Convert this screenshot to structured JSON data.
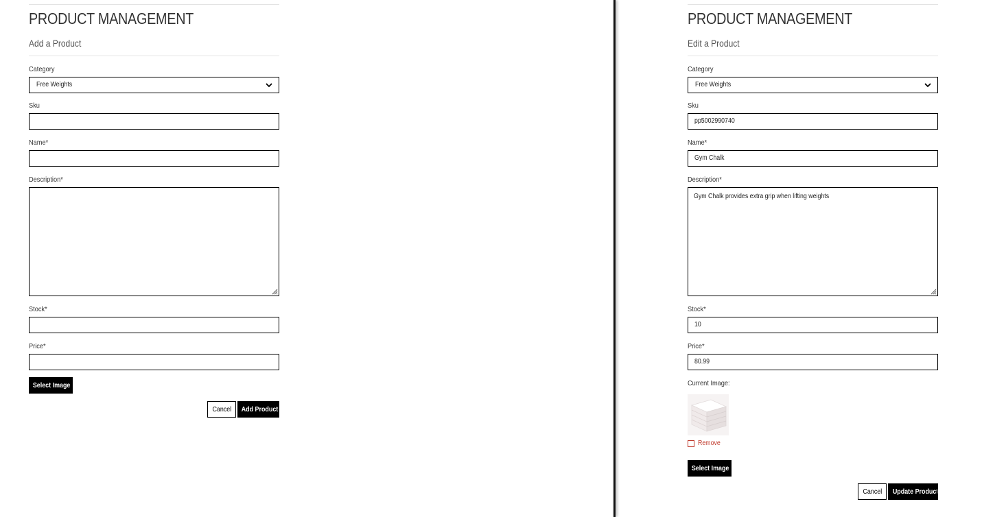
{
  "add_form": {
    "page_title": "PRODUCT MANAGEMENT",
    "subtitle": "Add a Product",
    "category": {
      "label": "Category",
      "value": "Free Weights"
    },
    "sku": {
      "label": "Sku",
      "value": ""
    },
    "name": {
      "label": "Name*",
      "value": ""
    },
    "description": {
      "label": "Description*",
      "value": ""
    },
    "stock": {
      "label": "Stock*",
      "value": ""
    },
    "price": {
      "label": "Price*",
      "value": ""
    },
    "select_image_label": "Select Image",
    "cancel_label": "Cancel",
    "submit_label": "Add Product"
  },
  "edit_form": {
    "page_title": "PRODUCT MANAGEMENT",
    "subtitle": "Edit a Product",
    "category": {
      "label": "Category",
      "value": "Free Weights"
    },
    "sku": {
      "label": "Sku",
      "value": "pp5002990740"
    },
    "name": {
      "label": "Name*",
      "value": "Gym Chalk"
    },
    "description": {
      "label": "Description*",
      "value": "Gym Chalk provides extra grip when lifting weights"
    },
    "stock": {
      "label": "Stock*",
      "value": "10"
    },
    "price": {
      "label": "Price*",
      "value": "80.99"
    },
    "current_image_label": "Current Image:",
    "remove_label": "Remove",
    "remove_checked": false,
    "select_image_label": "Select Image",
    "cancel_label": "Cancel",
    "submit_label": "Update Product"
  },
  "colors": {
    "primary_button": "#000000",
    "remove_text": "#c0392b"
  },
  "icons": {
    "select_arrow": "chevron-down-icon",
    "textarea_resize": "resize-grip-icon"
  }
}
